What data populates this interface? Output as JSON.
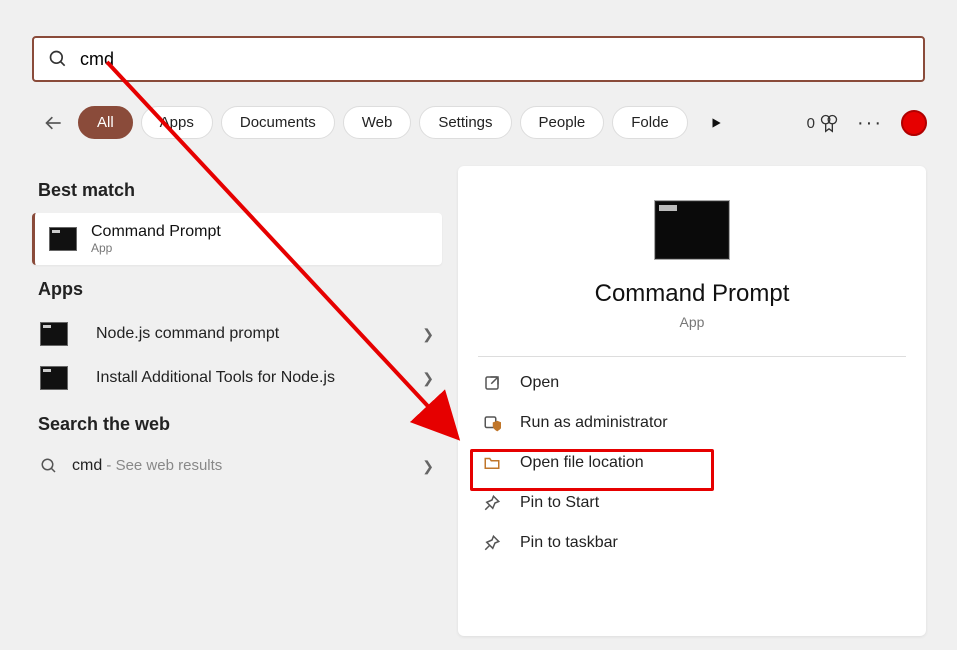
{
  "search": {
    "query": "cmd"
  },
  "filters": {
    "items": [
      "All",
      "Apps",
      "Documents",
      "Web",
      "Settings",
      "People",
      "Folde"
    ],
    "activeIndex": 0
  },
  "badge": {
    "count": "0"
  },
  "sections": {
    "bestMatch": "Best match",
    "apps": "Apps",
    "web": "Search the web"
  },
  "bestMatch": {
    "title": "Command Prompt",
    "subtitle": "App"
  },
  "appsList": [
    {
      "title": "Node.js command prompt"
    },
    {
      "title": "Install Additional Tools for Node.js"
    }
  ],
  "webResult": {
    "query": "cmd",
    "hint": " - See web results"
  },
  "preview": {
    "title": "Command Prompt",
    "subtitle": "App",
    "actions": [
      {
        "icon": "open",
        "label": "Open"
      },
      {
        "icon": "admin",
        "label": "Run as administrator"
      },
      {
        "icon": "folder",
        "label": "Open file location"
      },
      {
        "icon": "pin-start",
        "label": "Pin to Start"
      },
      {
        "icon": "pin-taskbar",
        "label": "Pin to taskbar"
      }
    ]
  }
}
